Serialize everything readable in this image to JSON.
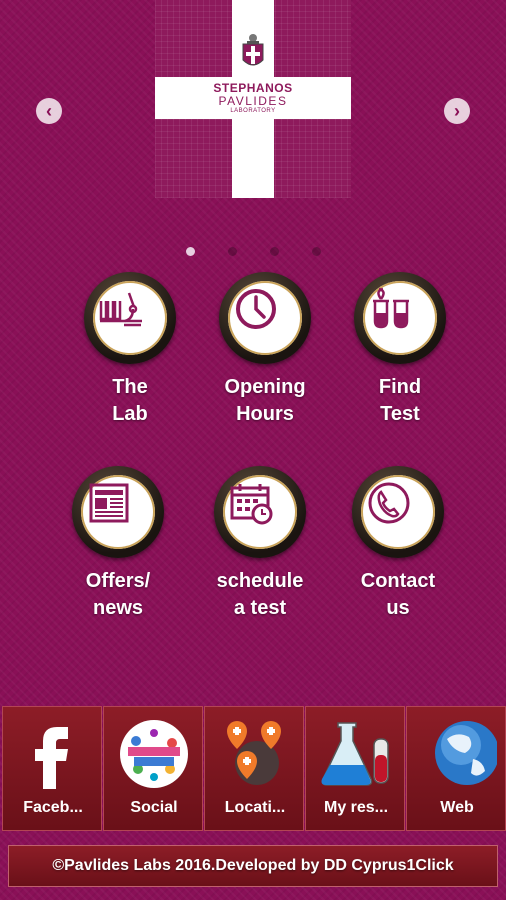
{
  "hero": {
    "brand_line1": "STEPHANOS",
    "brand_line2": "PAVLIDES",
    "brand_line3": "LABORATORY",
    "prev_icon": "chevron-left-icon",
    "next_icon": "chevron-right-icon",
    "active_slide": 1,
    "slide_count": 4
  },
  "menu": [
    {
      "label_line1": "The",
      "label_line2": "Lab",
      "icon": "microscope-icon"
    },
    {
      "label_line1": "Opening",
      "label_line2": "Hours",
      "icon": "clock-icon"
    },
    {
      "label_line1": "Find",
      "label_line2": "Test",
      "icon": "test-tubes-icon"
    },
    {
      "label_line1": "Offers/",
      "label_line2": "news",
      "icon": "newspaper-icon"
    },
    {
      "label_line1": "schedule",
      "label_line2": "a test",
      "icon": "calendar-icon"
    },
    {
      "label_line1": "Contact",
      "label_line2": "us",
      "icon": "phone-icon"
    }
  ],
  "bottom_bar": [
    {
      "label": "Faceb...",
      "icon": "facebook-icon"
    },
    {
      "label": "Social",
      "icon": "social-media-icon"
    },
    {
      "label": "Locati...",
      "icon": "location-pins-icon"
    },
    {
      "label": "My res...",
      "icon": "flask-icon"
    },
    {
      "label": "Web",
      "icon": "globe-icon"
    }
  ],
  "footer": {
    "text": "©Pavlides Labs 2016.Developed by DD Cyprus1Click"
  },
  "colors": {
    "background": "#8a1057",
    "accent": "#8e1a5c",
    "bar": "#7a1520"
  }
}
